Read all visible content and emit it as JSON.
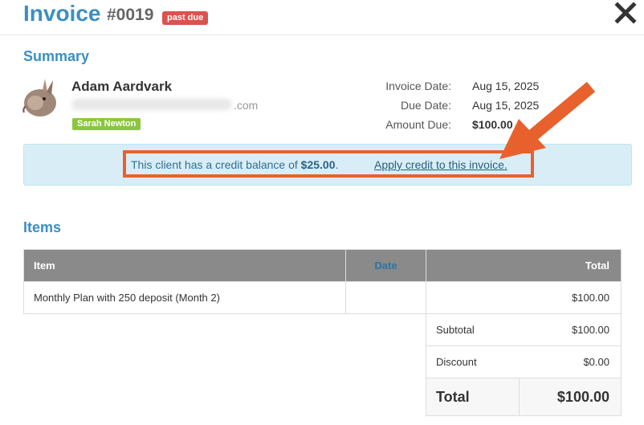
{
  "header": {
    "title": "Invoice",
    "number": "#0019",
    "status_badge": "past due",
    "close_icon": "close-icon"
  },
  "summary": {
    "section_title": "Summary",
    "client_name": "Adam Aardvark",
    "email_suffix": ".com",
    "staff_tag": "Sarah Newton",
    "avatar_icon": "aardvark-avatar",
    "invoice_date_label": "Invoice Date:",
    "invoice_date": "Aug 15, 2025",
    "due_date_label": "Due Date:",
    "due_date": "Aug 15, 2025",
    "amount_due_label": "Amount Due:",
    "amount_due": "$100.00"
  },
  "credit": {
    "text_prefix": "This client has a credit balance of ",
    "amount": "$25.00",
    "text_suffix": ".",
    "link": "Apply credit to this invoice."
  },
  "items": {
    "section_title": "Items",
    "columns": {
      "item": "Item",
      "date": "Date",
      "total": "Total"
    },
    "rows": [
      {
        "item": "Monthly Plan with 250 deposit (Month 2)",
        "date": "",
        "total": "$100.00"
      }
    ],
    "subtotal_label": "Subtotal",
    "subtotal": "$100.00",
    "discount_label": "Discount",
    "discount": "$0.00",
    "total_label": "Total",
    "total": "$100.00"
  },
  "colors": {
    "accent": "#3a8fc4",
    "badge": "#d9534f",
    "tag": "#8cc63f",
    "highlight": "#e8612c",
    "alert_bg": "#d9edf7"
  }
}
